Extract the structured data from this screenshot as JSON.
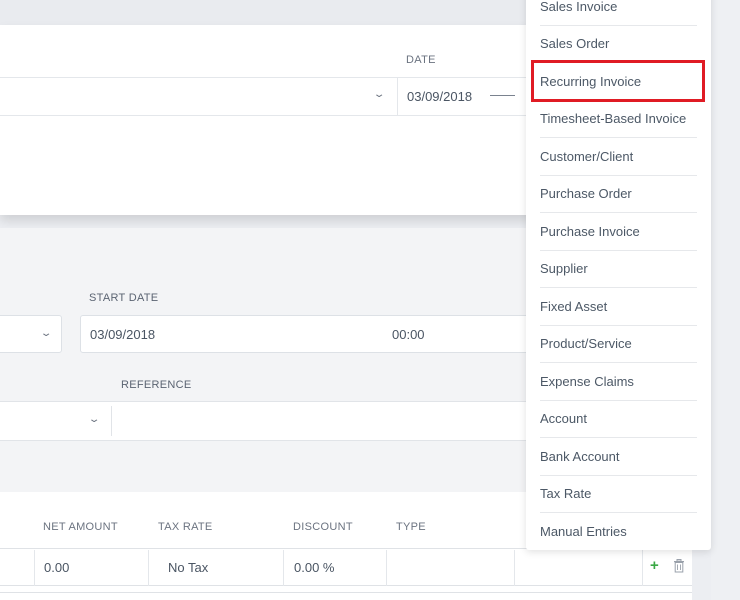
{
  "modal": {
    "date_label": "DATE",
    "date_value": "03/09/2018"
  },
  "form": {
    "start_date_label": "START DATE",
    "start_date_value": "03/09/2018",
    "start_time_value": "00:00",
    "reference_label": "REFERENCE"
  },
  "table": {
    "headers": [
      "NET AMOUNT",
      "TAX RATE",
      "DISCOUNT",
      "TYPE"
    ],
    "row": {
      "net_amount": "0.00",
      "tax_rate": "No Tax",
      "discount": "0.00 %"
    }
  },
  "menu": {
    "items": [
      "Sales Invoice",
      "Sales Order",
      "Recurring Invoice",
      "Timesheet-Based Invoice",
      "Customer/Client",
      "Purchase Order",
      "Purchase Invoice",
      "Supplier",
      "Fixed Asset",
      "Product/Service",
      "Expense Claims",
      "Account",
      "Bank Account",
      "Tax Rate",
      "Manual Entries"
    ],
    "highlighted_index": 2
  },
  "colors": {
    "highlight_outline": "#e01b24",
    "add_icon": "#3aa845"
  }
}
